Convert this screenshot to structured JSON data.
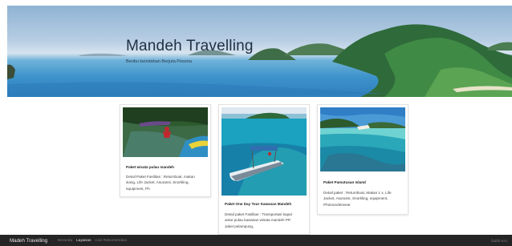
{
  "hero": {
    "title": "Mandeh Travelling",
    "subtitle": "Beribu keindahan Berjuta Pesona"
  },
  "cards": [
    {
      "title": "Paket wisata pulau mandeh",
      "description": "Detail Paket Fasilitas : Returnboat, makan siang, Life Jacket, Asuransi, Snorkling, equipment, Ph"
    },
    {
      "title": "Paket One Day Tour Kawasan Mandeh",
      "description": "Detail paket Fasilitas : Transportasi kapal antar pulau kawasan wisata mandeh PP, Jaket pelampung,"
    },
    {
      "title": "Paket Pamutusan Island",
      "description": "Detail paket : Returnboat, Makan 1 x, Life Jacket, Asuransi, Snorkling, equipment, Photounderwear"
    }
  ],
  "footer": {
    "brand": "Madeh Travelling",
    "nav": [
      "Beranda",
      "Layanan",
      "Cari Rekomendasi"
    ],
    "active_nav": "Layanan",
    "credit": "fadhli-ezu"
  },
  "colors": {
    "footer_bg": "#252525",
    "hero_sky": "#b7cde3",
    "hero_sea": "#3d93cb"
  }
}
